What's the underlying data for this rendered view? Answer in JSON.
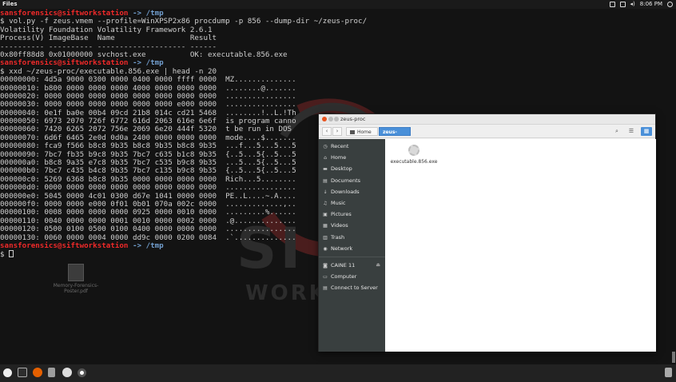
{
  "top_panel": {
    "title": "Files",
    "time": "8:06 PM",
    "tray_icons": [
      "screen-icon",
      "keyboard-icon",
      "volume-icon",
      "power-icon"
    ]
  },
  "desktop": {
    "file_label": "Memory-Forensics-Poster.pdf",
    "bg_letters": "SI",
    "bg_work": "WORK"
  },
  "terminal": {
    "lines": [
      {
        "type": "prompt",
        "user": "sansforensics@siftworkstation",
        "path": "-> /tmp"
      },
      {
        "type": "text",
        "text": "$ vol.py -f zeus.vmem --profile=WinXPSP2x86 procdump -p 856 --dump-dir ~/zeus-proc/"
      },
      {
        "type": "text",
        "text": "Volatility Foundation Volatility Framework 2.6.1"
      },
      {
        "type": "text",
        "text": "Process(V) ImageBase  Name                 Result"
      },
      {
        "type": "text",
        "text": "---------- ---------- -------------------- ------"
      },
      {
        "type": "text",
        "text": "0x80ff88d8 0x01000000 svchost.exe          OK: executable.856.exe"
      },
      {
        "type": "prompt",
        "user": "sansforensics@siftworkstation",
        "path": "-> /tmp"
      },
      {
        "type": "text",
        "text": "$ xxd ~/zeus-proc/executable.856.exe | head -n 20"
      },
      {
        "type": "text",
        "text": "00000000: 4d5a 9000 0300 0000 0400 0000 ffff 0000  MZ.............."
      },
      {
        "type": "text",
        "text": "00000010: b800 0000 0000 0000 4000 0000 0000 0000  ........@......."
      },
      {
        "type": "text",
        "text": "00000020: 0000 0000 0000 0000 0000 0000 0000 0000  ................"
      },
      {
        "type": "text",
        "text": "00000030: 0000 0000 0000 0000 0000 0000 e000 0000  ................"
      },
      {
        "type": "text",
        "text": "00000040: 0e1f ba0e 00b4 09cd 21b8 014c cd21 5468  ........!..L.!Th"
      },
      {
        "type": "text",
        "text": "00000050: 6973 2070 726f 6772 616d 2063 616e 6e6f  is program canno"
      },
      {
        "type": "text",
        "text": "00000060: 7420 6265 2072 756e 2069 6e20 444f 5320  t be run in DOS "
      },
      {
        "type": "text",
        "text": "00000070: 6d6f 6465 2e0d 0d0a 2400 0000 0000 0000  mode....$......."
      },
      {
        "type": "text",
        "text": "00000080: fca9 f566 b8c8 9b35 b8c8 9b35 b8c8 9b35  ...f...5...5...5"
      },
      {
        "type": "text",
        "text": "00000090: 7bc7 fb35 b9c8 9b35 7bc7 c635 b1c8 9b35  {..5...5{..5...5"
      },
      {
        "type": "text",
        "text": "000000a0: b8c8 9a35 e7c8 9b35 7bc7 c535 b9c8 9b35  ...5...5{..5...5"
      },
      {
        "type": "text",
        "text": "000000b0: 7bc7 c435 b4c8 9b35 7bc7 c135 b9c8 9b35  {..5...5{..5...5"
      },
      {
        "type": "text",
        "text": "000000c0: 5269 6368 b8c8 9b35 0000 0000 0000 0000  Rich...5........"
      },
      {
        "type": "text",
        "text": "000000d0: 0000 0000 0000 0000 0000 0000 0000 0000  ................"
      },
      {
        "type": "text",
        "text": "000000e0: 5045 0000 4c01 0300 d67e 1041 0000 0000  PE..L....~.A...."
      },
      {
        "type": "text",
        "text": "000000f0: 0000 0000 e000 0f01 0b01 070a 002c 0000  .............,.."
      },
      {
        "type": "text",
        "text": "00000100: 0008 0000 0000 0000 0925 0000 0010 0000  .........%......"
      },
      {
        "type": "text",
        "text": "00000110: 0040 0000 0000 0001 0010 0000 0002 0000  .@.............."
      },
      {
        "type": "text",
        "text": "00000120: 0500 0100 0500 0100 0400 0000 0000 0000  ................"
      },
      {
        "type": "text",
        "text": "00000130: 0060 0000 0004 0000 dd9c 0000 0200 0084  .`.............."
      },
      {
        "type": "prompt",
        "user": "sansforensics@siftworkstation",
        "path": "-> /tmp"
      },
      {
        "type": "cursor",
        "text": "$ "
      }
    ]
  },
  "file_manager": {
    "title": "zeus-proc",
    "breadcrumb_home": "Home",
    "breadcrumb_current": "zeus-proc",
    "sidebar": [
      {
        "icon": "clock-icon",
        "glyph": "◷",
        "label": "Recent"
      },
      {
        "icon": "home-icon",
        "glyph": "⌂",
        "label": "Home"
      },
      {
        "icon": "desktop-icon",
        "glyph": "▬",
        "label": "Desktop"
      },
      {
        "icon": "documents-icon",
        "glyph": "▤",
        "label": "Documents"
      },
      {
        "icon": "downloads-icon",
        "glyph": "↓",
        "label": "Downloads"
      },
      {
        "icon": "music-icon",
        "glyph": "♫",
        "label": "Music"
      },
      {
        "icon": "pictures-icon",
        "glyph": "▣",
        "label": "Pictures"
      },
      {
        "icon": "videos-icon",
        "glyph": "▦",
        "label": "Videos"
      },
      {
        "icon": "trash-icon",
        "glyph": "▥",
        "label": "Trash"
      },
      {
        "icon": "network-icon",
        "glyph": "◉",
        "label": "Network"
      }
    ],
    "devices": [
      {
        "icon": "drive-icon",
        "glyph": "◙",
        "label": "CAINE 11",
        "eject": true
      },
      {
        "icon": "computer-icon",
        "glyph": "▭",
        "label": "Computer"
      },
      {
        "icon": "server-icon",
        "glyph": "▤",
        "label": "Connect to Server"
      }
    ],
    "files": [
      {
        "name": "executable.856.exe"
      }
    ]
  },
  "dock": {
    "icons": [
      "apps-icon",
      "terminal-icon",
      "firefox-icon",
      "files-icon",
      "settings-icon",
      "record-icon"
    ]
  }
}
